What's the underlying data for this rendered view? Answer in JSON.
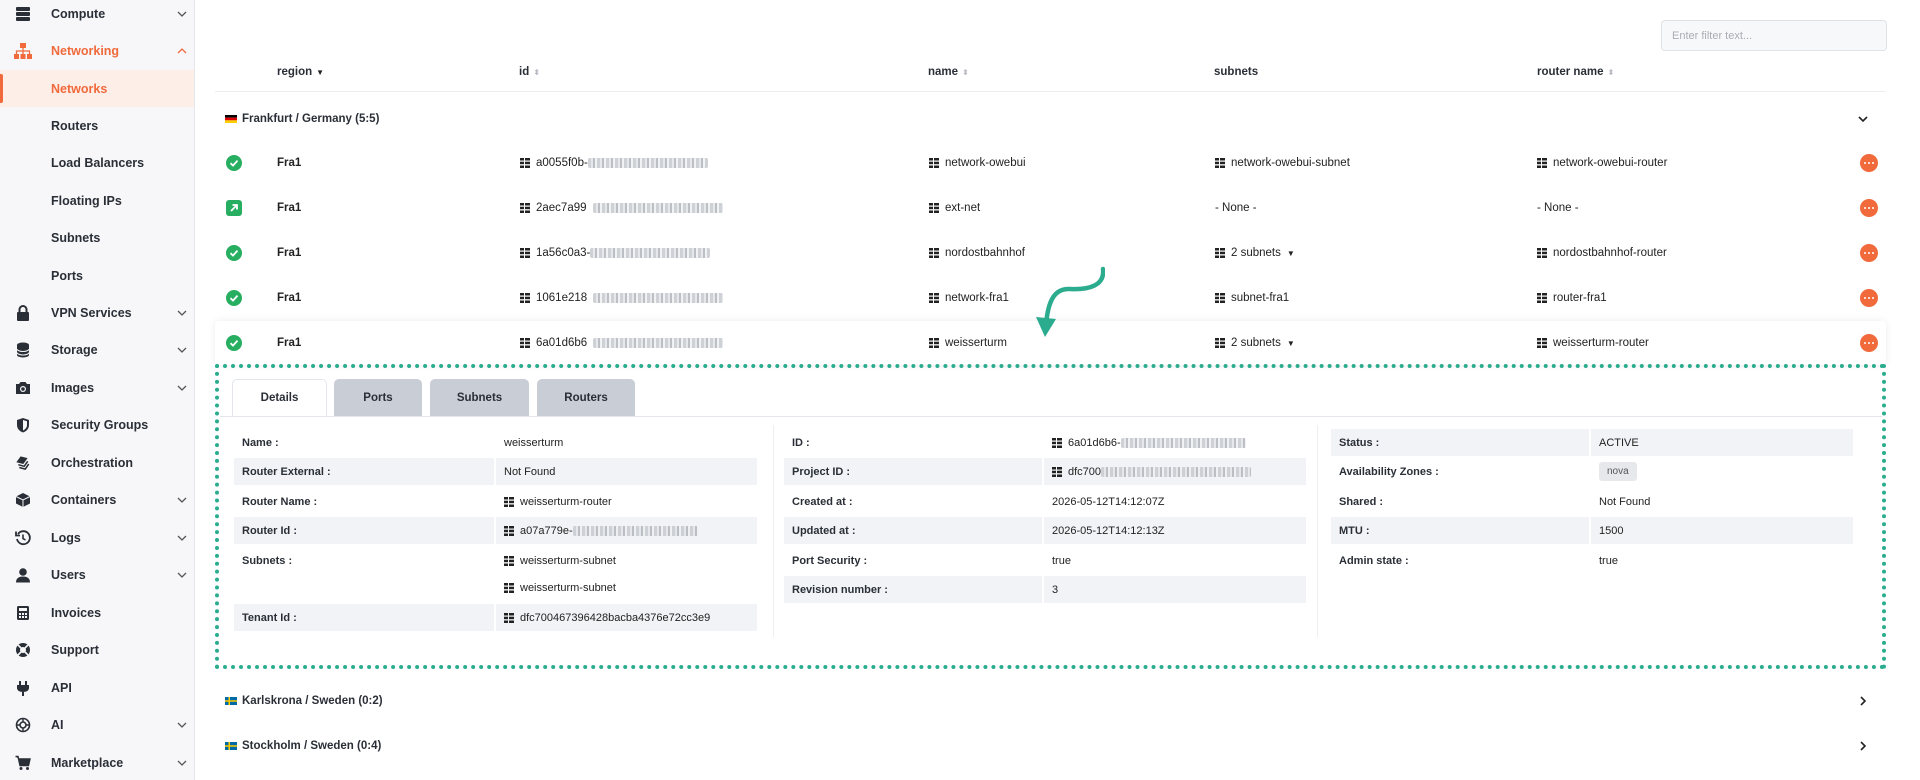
{
  "sidebar": {
    "items": [
      {
        "label": "Compute",
        "icon": "server-icon",
        "top": 0
      },
      {
        "label": "Networking",
        "icon": "network-icon",
        "expanded": true
      },
      {
        "label": "VPN Services",
        "icon": "lock-icon"
      },
      {
        "label": "Storage",
        "icon": "database-icon"
      },
      {
        "label": "Images",
        "icon": "camera-icon"
      },
      {
        "label": "Security Groups",
        "icon": "shield-icon"
      },
      {
        "label": "Orchestration",
        "icon": "layers-icon"
      },
      {
        "label": "Containers",
        "icon": "box-icon"
      },
      {
        "label": "Logs",
        "icon": "history-icon"
      },
      {
        "label": "Users",
        "icon": "user-icon"
      },
      {
        "label": "Invoices",
        "icon": "calculator-icon"
      },
      {
        "label": "Support",
        "icon": "lifebuoy-icon"
      },
      {
        "label": "API",
        "icon": "plug-icon"
      },
      {
        "label": "AI",
        "icon": "brain-icon"
      },
      {
        "label": "Marketplace",
        "icon": "cart-icon"
      }
    ],
    "networking_sub": [
      "Networks",
      "Routers",
      "Load Balancers",
      "Floating IPs",
      "Subnets",
      "Ports"
    ],
    "active_sub": "Networks"
  },
  "filter": {
    "placeholder": "Enter filter text..."
  },
  "columns": {
    "region": "region",
    "id": "id",
    "name": "name",
    "subnets": "subnets",
    "router": "router name"
  },
  "groups": {
    "frankfurt": "Frankfurt / Germany (5:5)",
    "karlskrona": "Karlskrona / Sweden (0:2)",
    "stockholm": "Stockholm / Sweden (0:4)"
  },
  "rows": [
    {
      "region": "Fra1",
      "status": "active",
      "id": "a0055f0b-",
      "name": "network-owebui",
      "subnets": "network-owebui-subnet",
      "router": "network-owebui-router"
    },
    {
      "region": "Fra1",
      "status": "external",
      "id": "2aec7a99",
      "name": "ext-net",
      "subnets": "- None -",
      "router": "- None -"
    },
    {
      "region": "Fra1",
      "status": "active",
      "id": "1a56c0a3-",
      "name": "nordostbahnhof",
      "subnets": "2 subnets",
      "router": "nordostbahnhof-router"
    },
    {
      "region": "Fra1",
      "status": "active",
      "id": "1061e218",
      "name": "network-fra1",
      "subnets": "subnet-fra1",
      "router": "router-fra1"
    },
    {
      "region": "Fra1",
      "status": "active",
      "id": "6a01d6b6",
      "name": "weisserturm",
      "subnets": "2 subnets",
      "router": "weisserturm-router"
    }
  ],
  "tabs": [
    "Details",
    "Ports",
    "Subnets",
    "Routers"
  ],
  "details": {
    "col1": [
      {
        "label": "Name :",
        "value": "weisserturm"
      },
      {
        "label": "Router External :",
        "value": "Not Found"
      },
      {
        "label": "Router Name :",
        "value": "weisserturm-router",
        "icon": true
      },
      {
        "label": "Router Id :",
        "value": "a07a779e-",
        "icon": true,
        "blur": true
      },
      {
        "label": "Subnets :",
        "value": "weisserturm-subnet",
        "icon": true
      },
      {
        "label": "",
        "value": "weisserturm-subnet",
        "icon": true
      },
      {
        "label": "Tenant Id :",
        "value": "dfc700467396428bacba4376e72cc3e9",
        "icon": true
      }
    ],
    "col2": [
      {
        "label": "ID :",
        "value": "6a01d6b6-",
        "icon": true,
        "blur": true
      },
      {
        "label": "Project ID :",
        "value": "dfc700",
        "icon": true,
        "blur": true
      },
      {
        "label": "Created at :",
        "value": "2026-05-12T14:12:07Z"
      },
      {
        "label": "Updated at :",
        "value": "2026-05-12T14:12:13Z"
      },
      {
        "label": "Port Security :",
        "value": "true"
      },
      {
        "label": "Revision number :",
        "value": "3"
      }
    ],
    "col3": [
      {
        "label": "Status :",
        "value": "ACTIVE"
      },
      {
        "label": "Availability Zones :",
        "value": "nova",
        "badge": true
      },
      {
        "label": "Shared :",
        "value": "Not Found"
      },
      {
        "label": "MTU :",
        "value": "1500"
      },
      {
        "label": "Admin state :",
        "value": "true"
      }
    ]
  },
  "colors": {
    "accent": "#f06a3c",
    "success": "#27ae60",
    "annotation": "#2bac8f"
  }
}
